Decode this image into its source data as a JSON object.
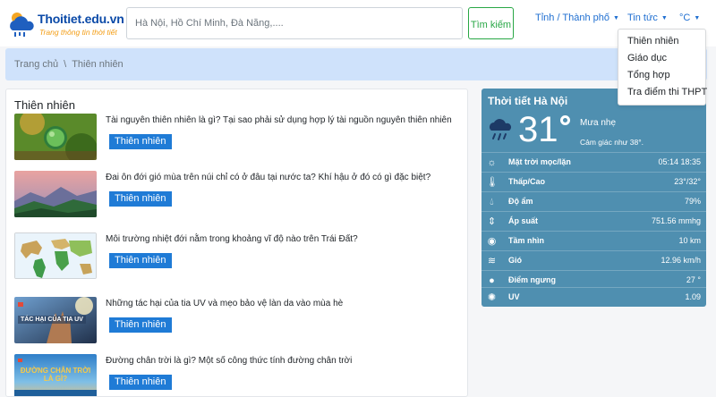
{
  "header": {
    "logo_title": "Thoitiet.edu.vn",
    "logo_subtitle": "Trang thông tin thời tiết",
    "search_placeholder": "Hà Nội, Hồ Chí Minh, Đà Nẵng,....",
    "search_button": "Tìm kiếm",
    "nav": {
      "province": "Tỉnh / Thành phố",
      "news": "Tin tức",
      "unit": "°C"
    }
  },
  "breadcrumb": {
    "home": "Trang chủ",
    "separator": "\\",
    "current": "Thiên nhiên"
  },
  "dropdown": {
    "items": [
      {
        "label": "Thiên nhiên"
      },
      {
        "label": "Giáo dục"
      },
      {
        "label": "Tổng hợp"
      },
      {
        "label": "Tra điểm thi THPT"
      }
    ]
  },
  "news": {
    "heading": "Thiên nhiên",
    "items": [
      {
        "title": "Tài nguyên thiên nhiên là gì? Tại sao phải sử dụng hợp lý tài nguồn nguyên thiên nhiên",
        "tag": "Thiên nhiên"
      },
      {
        "title": "Đai ôn đới gió mùa trên núi chỉ có ở đâu tại nước ta? Khí hậu ở đó có gì đặc biệt?",
        "tag": "Thiên nhiên"
      },
      {
        "title": "Môi trường nhiệt đới nằm trong khoảng vĩ độ nào trên Trái Đất?",
        "tag": "Thiên nhiên"
      },
      {
        "title": "Những tác hại của tia UV và mẹo bảo vệ làn da vào mùa hè",
        "tag": "Thiên nhiên",
        "thumb_text": "TÁC HẠI CỦA TIA UV"
      },
      {
        "title": "Đường chân trời là gì? Một số công thức tính đường chân trời",
        "tag": "Thiên nhiên",
        "thumb_text": "ĐƯỜNG CHÂN TRỜI LÀ GÌ?"
      }
    ]
  },
  "weather": {
    "title": "Thời tiết Hà Nội",
    "temp": "31",
    "description": "Mưa nhẹ",
    "feels_like": "Cảm giác như 38°.",
    "rows": [
      {
        "icon": "sun-icon",
        "label": "Mặt trời mọc/lặn",
        "value": "05:14  18:35"
      },
      {
        "icon": "thermometer-icon",
        "label": "Thấp/Cao",
        "value": "23°/32°"
      },
      {
        "icon": "droplet-icon",
        "label": "Độ ẩm",
        "value": "79%"
      },
      {
        "icon": "pressure-icon",
        "label": "Áp suất",
        "value": "751.56 mmhg"
      },
      {
        "icon": "eye-icon",
        "label": "Tầm nhìn",
        "value": "10 km"
      },
      {
        "icon": "wind-icon",
        "label": "Gió",
        "value": "12.96 km/h"
      },
      {
        "icon": "dewpoint-icon",
        "label": "Điểm ngưng",
        "value": "27 °"
      },
      {
        "icon": "uv-icon",
        "label": "UV",
        "value": "1.09"
      }
    ]
  }
}
